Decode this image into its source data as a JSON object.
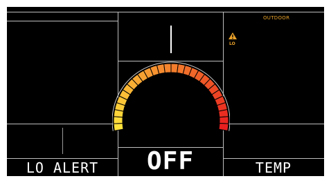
{
  "display": {
    "outdoor_label": "OUTDOOR",
    "alert_badge": "LO",
    "alert_icon": "warning-triangle-icon",
    "bottom_left_label": "LO ALERT",
    "bottom_center_value": "OFF",
    "bottom_right_label": "TEMP"
  },
  "colors": {
    "background": "#000000",
    "gridline": "#bfbfbf",
    "accent_orange": "#e8a12a",
    "gauge_start": "#ffe23b",
    "gauge_end": "#e81f1f"
  }
}
